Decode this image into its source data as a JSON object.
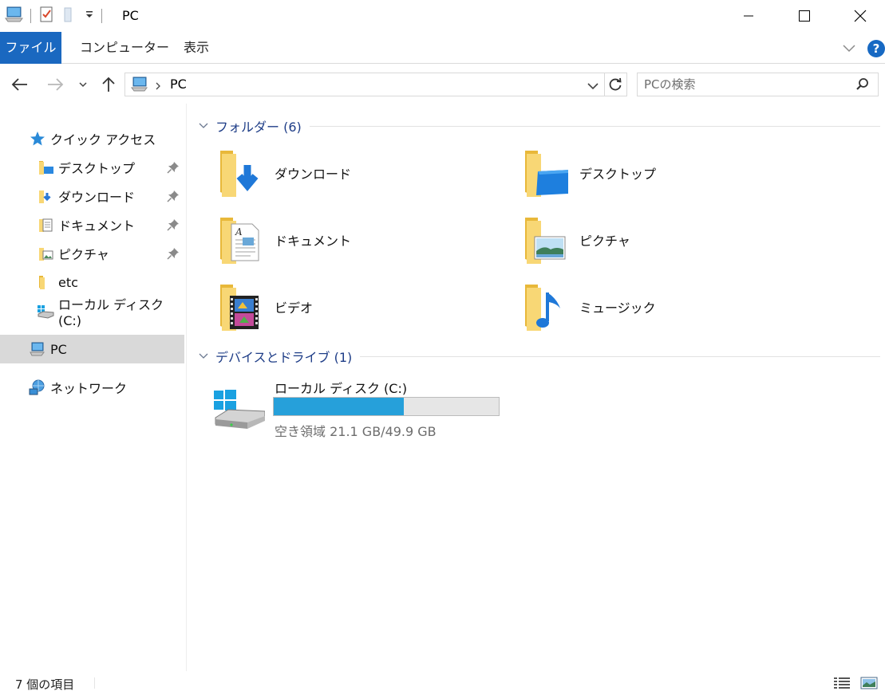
{
  "window": {
    "title": "PC"
  },
  "ribbon": {
    "tabs": [
      "ファイル",
      "コンピューター",
      "表示"
    ]
  },
  "address": {
    "crumb": "PC"
  },
  "search": {
    "placeholder": "PCの検索"
  },
  "sidebar": {
    "quick_access": "クイック アクセス",
    "items": [
      {
        "label": "デスクトップ",
        "icon": "desktop-folder-icon",
        "pinned": true
      },
      {
        "label": "ダウンロード",
        "icon": "download-folder-icon",
        "pinned": true
      },
      {
        "label": "ドキュメント",
        "icon": "documents-folder-icon",
        "pinned": true
      },
      {
        "label": "ピクチャ",
        "icon": "pictures-folder-icon",
        "pinned": true
      },
      {
        "label": "etc",
        "icon": "folder-icon",
        "pinned": false
      },
      {
        "label": "ローカル ディスク (C:)",
        "icon": "drive-icon",
        "pinned": false
      }
    ],
    "pc": "PC",
    "network": "ネットワーク"
  },
  "content": {
    "folders_header": "フォルダー (6)",
    "folders": [
      {
        "label": "ダウンロード",
        "icon": "download-folder-icon"
      },
      {
        "label": "デスクトップ",
        "icon": "desktop-folder-icon"
      },
      {
        "label": "ドキュメント",
        "icon": "documents-folder-icon"
      },
      {
        "label": "ピクチャ",
        "icon": "pictures-folder-icon"
      },
      {
        "label": "ビデオ",
        "icon": "videos-folder-icon"
      },
      {
        "label": "ミュージック",
        "icon": "music-folder-icon"
      }
    ],
    "devices_header": "デバイスとドライブ (1)",
    "drive": {
      "label": "ローカル ディスク (C:)",
      "free_text": "空き領域 21.1 GB/49.9 GB",
      "used_fraction": 0.577
    }
  },
  "status": {
    "item_count": "7 個の項目"
  },
  "colors": {
    "accent": "#1a68c0",
    "drive_bar": "#26a0da",
    "group_header": "#1e3d87",
    "folder": "#f8d775"
  }
}
